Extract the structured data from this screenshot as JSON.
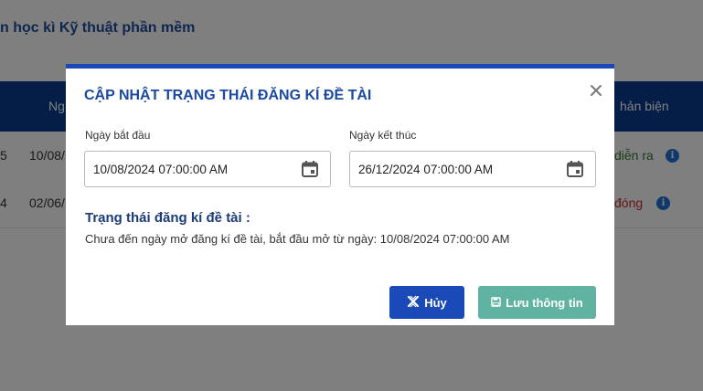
{
  "background": {
    "page_title": "n học kì Kỹ thuật phần mềm",
    "table_headers": {
      "col_start": "Ng",
      "col_review": "hản biện"
    },
    "rows": [
      {
        "idx": "5",
        "start": "10/08/",
        "status": "diễn ra"
      },
      {
        "idx": "4",
        "start": "02/06/",
        "status": "đóng"
      }
    ]
  },
  "modal": {
    "title": "CẬP NHẬT TRẠNG THÁI ĐĂNG KÍ ĐỀ TÀI",
    "start_label": "Ngày bắt đầu",
    "start_value": "10/08/2024 07:00:00 AM",
    "end_label": "Ngày kết thúc",
    "end_value": "26/12/2024 07:00:00 AM",
    "status_heading": "Trạng thái đăng kí đề tài :",
    "status_text": "Chưa đến ngày mở đăng kí đề tài, bắt đầu mở từ ngày: 10/08/2024 07:00:00 AM",
    "cancel_label": "Hủy",
    "save_label": "Lưu thông tin"
  },
  "colors": {
    "primary": "#1a4ab8",
    "save": "#5fb3a0",
    "header_bg": "#0b3d91",
    "info_icon": "#1e73d8"
  }
}
